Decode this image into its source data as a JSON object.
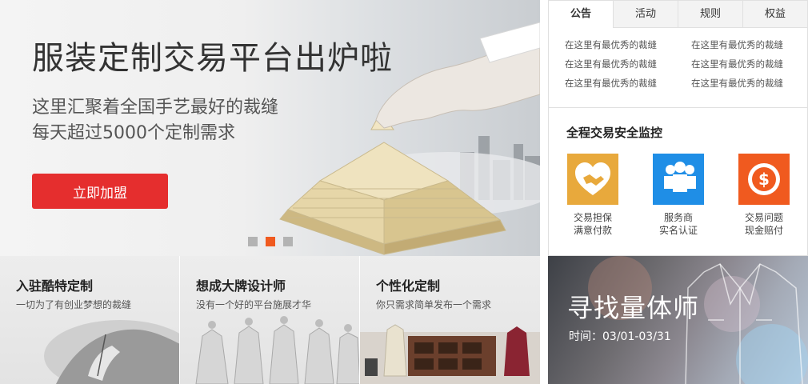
{
  "hero": {
    "title": "服装定制交易平台出炉啦",
    "line1": "这里汇聚着全国手艺最好的裁缝",
    "line2": "每天超过5000个定制需求",
    "cta_label": "立即加盟",
    "slide_count": 3,
    "active_slide": 2
  },
  "cards": [
    {
      "title": "入驻酷特定制",
      "subtitle": "一切为了有创业梦想的裁缝"
    },
    {
      "title": "想成大牌设计师",
      "subtitle": "没有一个好的平台施展才华"
    },
    {
      "title": "个性化定制",
      "subtitle": "你只需求简单发布一个需求"
    }
  ],
  "notice": {
    "tabs": [
      "公告",
      "活动",
      "规则",
      "权益"
    ],
    "active_tab": "公告",
    "items": [
      "在这里有最优秀的裁缝",
      "在这里有最优秀的裁缝",
      "在这里有最优秀的裁缝",
      "在这里有最优秀的裁缝",
      "在这里有最优秀的裁缝",
      "在这里有最优秀的裁缝"
    ]
  },
  "safety": {
    "title": "全程交易安全监控",
    "items": [
      {
        "icon": "handshake-heart-icon",
        "color": "#e8a93c",
        "line1": "交易担保",
        "line2": "满意付款"
      },
      {
        "icon": "people-icon",
        "color": "#1f8ee6",
        "line1": "服务商",
        "line2": "实名认证"
      },
      {
        "icon": "coin-refund-icon",
        "color": "#f05a1f",
        "line1": "交易问题",
        "line2": "现金赔付"
      }
    ]
  },
  "banner": {
    "title": "寻找量体师",
    "date": "时间：03/01-03/31"
  },
  "colors": {
    "accent_red": "#e52e2e",
    "dot_active": "#f05a1f",
    "dot_inactive": "#b3b3b3"
  }
}
